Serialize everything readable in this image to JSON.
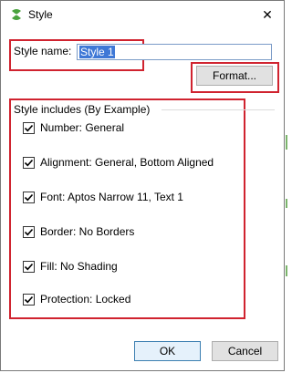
{
  "window": {
    "title": "Style",
    "close_glyph": "✕",
    "app_icon": "excel-style-icon"
  },
  "style_name": {
    "label": "Style name:",
    "value": "Style 1"
  },
  "buttons": {
    "format": "Format...",
    "ok": "OK",
    "cancel": "Cancel"
  },
  "includes": {
    "title": "Style includes (By Example)",
    "items": [
      {
        "label": "Number: General",
        "checked": true
      },
      {
        "label": "Alignment: General, Bottom Aligned",
        "checked": true
      },
      {
        "label": "Font: Aptos Narrow 11, Text 1",
        "checked": true
      },
      {
        "label": "Border: No Borders",
        "checked": true
      },
      {
        "label": "Fill: No Shading",
        "checked": true
      },
      {
        "label": "Protection: Locked",
        "checked": true
      }
    ]
  },
  "colors": {
    "highlight_box": "#d0232f",
    "selection": "#3f78d6",
    "app_icon": "#4aa33e"
  }
}
